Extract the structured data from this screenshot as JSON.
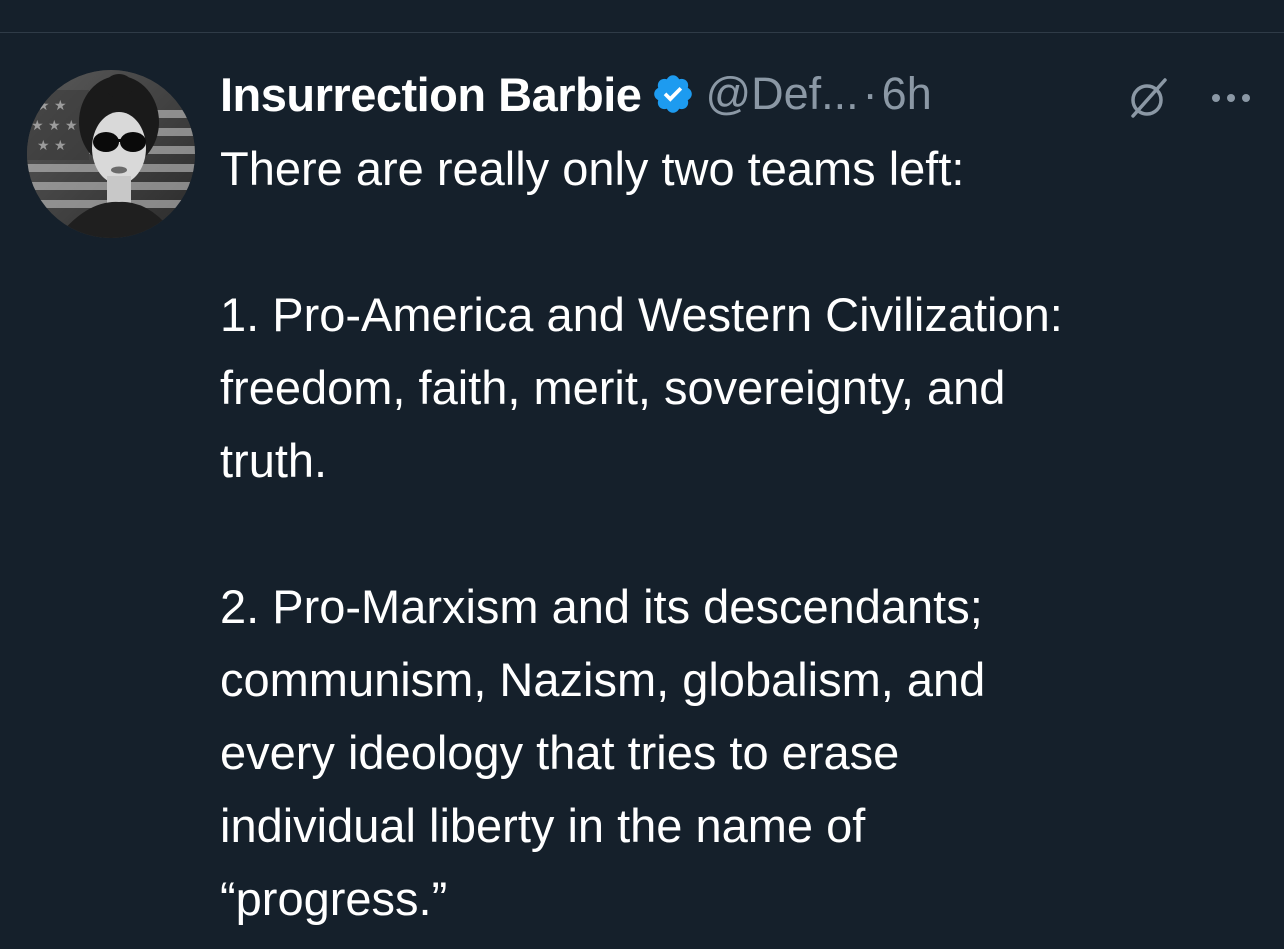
{
  "tweet": {
    "author": {
      "display_name": "Insurrection Barbie",
      "handle": "@Def...",
      "verified": true
    },
    "separator": "·",
    "time": "6h",
    "body": {
      "intro": "There are really only two teams left:",
      "point1_line1": "1. Pro-America and Western Civilization:",
      "point1_line2": "freedom, faith, merit, sovereignty, and",
      "point1_line3": "truth.",
      "point2_line1": "2. Pro-Marxism and its descendants;",
      "point2_line2": "communism, Nazism, globalism, and",
      "point2_line3": "every ideology that tries to erase",
      "point2_line4": "individual liberty in the name of",
      "point2_line5": "“progress.”"
    }
  },
  "icons": {
    "verified": "verified-badge-icon",
    "grok": "grok-icon",
    "more": "more-options-icon"
  },
  "colors": {
    "background": "#15202b",
    "text": "#ffffff",
    "muted": "#8b98a5",
    "verified": "#1d9bf0"
  }
}
